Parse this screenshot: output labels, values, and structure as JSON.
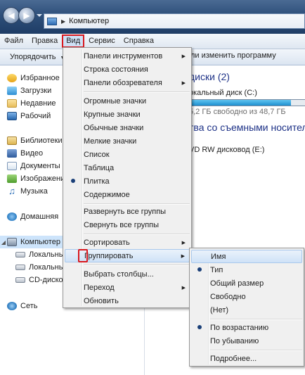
{
  "address": {
    "path": "Компьютер"
  },
  "menubar": {
    "items": [
      "Файл",
      "Правка",
      "Вид",
      "Сервис",
      "Справка"
    ]
  },
  "toolbar": {
    "organize": "Упорядочить",
    "right_text": "ли изменить программу"
  },
  "navpane": {
    "items": [
      {
        "label": "Избранное",
        "icon": "star-icon"
      },
      {
        "label": "Загрузки",
        "icon": "downloads-folder-icon"
      },
      {
        "label": "Недавние",
        "icon": "recent-places-icon"
      },
      {
        "label": "Рабочий",
        "icon": "desktop-icon"
      },
      {
        "label": "Библиотеки",
        "icon": "libraries-icon"
      },
      {
        "label": "Видео",
        "icon": "video-library-icon"
      },
      {
        "label": "Документы",
        "icon": "documents-library-icon"
      },
      {
        "label": "Изображения",
        "icon": "pictures-library-icon"
      },
      {
        "label": "Музыка",
        "icon": "music-library-icon"
      },
      {
        "label": "Домашняя",
        "icon": "homegroup-icon"
      },
      {
        "label": "Компьютер",
        "icon": "computer-icon"
      },
      {
        "label": "Локальный",
        "icon": "local-disk-icon"
      },
      {
        "label": "Локальный",
        "icon": "local-disk-icon"
      },
      {
        "label": "CD-дисковод",
        "icon": "cd-drive-icon"
      },
      {
        "label": "Сеть",
        "icon": "network-icon"
      }
    ]
  },
  "content": {
    "hdd_group": "диски (2)",
    "drive_label": "окальный диск (C:)",
    "drive_used_fraction": 0.88,
    "drive_free": "5,2 ГБ свободно из 48,7 ГБ",
    "removable_group": "тва со съемными носителя",
    "dvd_label": "VD RW дисковод (E:)"
  },
  "view_menu": {
    "items": [
      "Панели инструментов",
      "Строка состояния",
      "Панели обозревателя",
      "Огромные значки",
      "Крупные значки",
      "Обычные значки",
      "Мелкие значки",
      "Список",
      "Таблица",
      "Плитка",
      "Содержимое",
      "Развернуть все группы",
      "Свернуть все группы",
      "Сортировать",
      "Группировать",
      "Выбрать столбцы...",
      "Переход",
      "Обновить"
    ]
  },
  "group_menu": {
    "items": [
      "Имя",
      "Тип",
      "Общий размер",
      "Свободно",
      "(Нет)",
      "По возрастанию",
      "По убыванию",
      "Подробнее..."
    ]
  },
  "colors": {
    "highlight": "#d9181e",
    "group_header": "#1e3287"
  }
}
